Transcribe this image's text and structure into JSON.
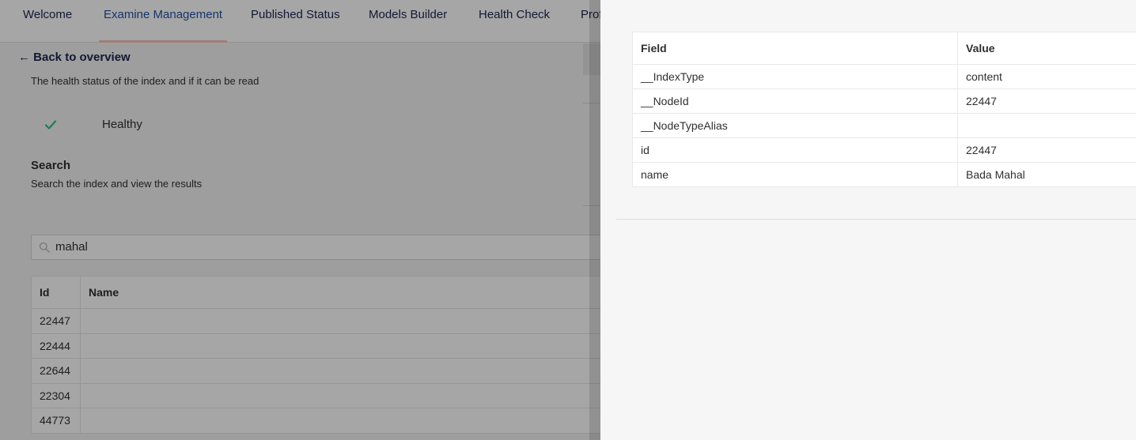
{
  "tabs": [
    {
      "label": "Welcome",
      "active": false
    },
    {
      "label": "Examine Management",
      "active": true
    },
    {
      "label": "Published Status",
      "active": false
    },
    {
      "label": "Models Builder",
      "active": false
    },
    {
      "label": "Health Check",
      "active": false
    },
    {
      "label": "Prof",
      "active": false
    }
  ],
  "back_link": "← Back to overview",
  "health": {
    "description": "The health status of the index and if it can be read",
    "status": "Healthy",
    "status_color": "#2bc37c"
  },
  "search": {
    "title": "Search",
    "description": "Search the index and view the results",
    "value": "mahal"
  },
  "results": {
    "headers": [
      "Id",
      "Name"
    ],
    "rows": [
      {
        "id": "22447",
        "name": ""
      },
      {
        "id": "22444",
        "name": ""
      },
      {
        "id": "22644",
        "name": ""
      },
      {
        "id": "22304",
        "name": ""
      },
      {
        "id": "44773",
        "name": ""
      }
    ]
  },
  "panel": {
    "headers": [
      "Field",
      "Value"
    ],
    "rows": [
      {
        "field": "__IndexType",
        "value": "content"
      },
      {
        "field": "__NodeId",
        "value": "22447"
      },
      {
        "field": "__NodeTypeAlias",
        "value": ""
      },
      {
        "field": "id",
        "value": "22447"
      },
      {
        "field": "name",
        "value": "Bada Mahal"
      }
    ]
  },
  "colors": {
    "accent": "#2152a3",
    "active_tab_underline": "#f5c1bc",
    "text": "#303033"
  }
}
